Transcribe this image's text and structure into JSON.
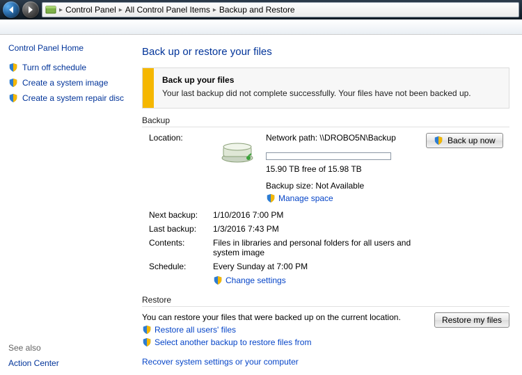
{
  "breadcrumb": {
    "root": "",
    "items": [
      "Control Panel",
      "All Control Panel Items",
      "Backup and Restore"
    ]
  },
  "sidebar": {
    "home": "Control Panel Home",
    "tasks": [
      "Turn off schedule",
      "Create a system image",
      "Create a system repair disc"
    ],
    "seealso_head": "See also",
    "seealso": [
      "Action Center"
    ]
  },
  "page": {
    "title": "Back up or restore your files",
    "warning_title": "Back up your files",
    "warning_text": "Your last backup did not complete successfully. Your files have not been backed up."
  },
  "backup": {
    "section": "Backup",
    "location_label": "Location:",
    "network_path": "Network path: \\\\DROBO5N\\Backup",
    "free_space": "15.90 TB free of 15.98 TB",
    "size_label": "Backup size: Not Available",
    "manage_space": "Manage space",
    "backup_now_btn": "Back up now",
    "next_label": "Next backup:",
    "next_value": "1/10/2016 7:00 PM",
    "last_label": "Last backup:",
    "last_value": "1/3/2016 7:43 PM",
    "contents_label": "Contents:",
    "contents_value": "Files in libraries and personal folders for all users and system image",
    "schedule_label": "Schedule:",
    "schedule_value": "Every Sunday at 7:00 PM",
    "change_settings": "Change settings"
  },
  "restore": {
    "section": "Restore",
    "desc": "You can restore your files that were backed up on the current location.",
    "restore_all": "Restore all users' files",
    "select_another": "Select another backup to restore files from",
    "recover": "Recover system settings or your computer",
    "restore_btn": "Restore my files"
  }
}
